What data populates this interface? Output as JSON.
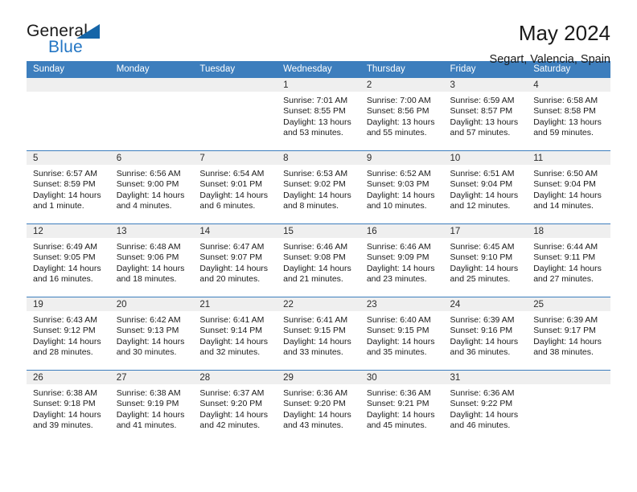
{
  "brand": {
    "name_part1": "General",
    "name_part2": "Blue",
    "triangle_color": "#1565a8",
    "blue_text_color": "#2376c4"
  },
  "header": {
    "title": "May 2024",
    "subtitle": "Segart, Valencia, Spain",
    "header_bg": "#3d7ebd",
    "header_text_color": "#ffffff",
    "daynum_band_bg": "#efefef"
  },
  "weekdays": [
    "Sunday",
    "Monday",
    "Tuesday",
    "Wednesday",
    "Thursday",
    "Friday",
    "Saturday"
  ],
  "weeks": [
    [
      {
        "day": "",
        "sunrise": "",
        "sunset": "",
        "daylight1": "",
        "daylight2": ""
      },
      {
        "day": "",
        "sunrise": "",
        "sunset": "",
        "daylight1": "",
        "daylight2": ""
      },
      {
        "day": "",
        "sunrise": "",
        "sunset": "",
        "daylight1": "",
        "daylight2": ""
      },
      {
        "day": "1",
        "sunrise": "Sunrise: 7:01 AM",
        "sunset": "Sunset: 8:55 PM",
        "daylight1": "Daylight: 13 hours",
        "daylight2": "and 53 minutes."
      },
      {
        "day": "2",
        "sunrise": "Sunrise: 7:00 AM",
        "sunset": "Sunset: 8:56 PM",
        "daylight1": "Daylight: 13 hours",
        "daylight2": "and 55 minutes."
      },
      {
        "day": "3",
        "sunrise": "Sunrise: 6:59 AM",
        "sunset": "Sunset: 8:57 PM",
        "daylight1": "Daylight: 13 hours",
        "daylight2": "and 57 minutes."
      },
      {
        "day": "4",
        "sunrise": "Sunrise: 6:58 AM",
        "sunset": "Sunset: 8:58 PM",
        "daylight1": "Daylight: 13 hours",
        "daylight2": "and 59 minutes."
      }
    ],
    [
      {
        "day": "5",
        "sunrise": "Sunrise: 6:57 AM",
        "sunset": "Sunset: 8:59 PM",
        "daylight1": "Daylight: 14 hours",
        "daylight2": "and 1 minute."
      },
      {
        "day": "6",
        "sunrise": "Sunrise: 6:56 AM",
        "sunset": "Sunset: 9:00 PM",
        "daylight1": "Daylight: 14 hours",
        "daylight2": "and 4 minutes."
      },
      {
        "day": "7",
        "sunrise": "Sunrise: 6:54 AM",
        "sunset": "Sunset: 9:01 PM",
        "daylight1": "Daylight: 14 hours",
        "daylight2": "and 6 minutes."
      },
      {
        "day": "8",
        "sunrise": "Sunrise: 6:53 AM",
        "sunset": "Sunset: 9:02 PM",
        "daylight1": "Daylight: 14 hours",
        "daylight2": "and 8 minutes."
      },
      {
        "day": "9",
        "sunrise": "Sunrise: 6:52 AM",
        "sunset": "Sunset: 9:03 PM",
        "daylight1": "Daylight: 14 hours",
        "daylight2": "and 10 minutes."
      },
      {
        "day": "10",
        "sunrise": "Sunrise: 6:51 AM",
        "sunset": "Sunset: 9:04 PM",
        "daylight1": "Daylight: 14 hours",
        "daylight2": "and 12 minutes."
      },
      {
        "day": "11",
        "sunrise": "Sunrise: 6:50 AM",
        "sunset": "Sunset: 9:04 PM",
        "daylight1": "Daylight: 14 hours",
        "daylight2": "and 14 minutes."
      }
    ],
    [
      {
        "day": "12",
        "sunrise": "Sunrise: 6:49 AM",
        "sunset": "Sunset: 9:05 PM",
        "daylight1": "Daylight: 14 hours",
        "daylight2": "and 16 minutes."
      },
      {
        "day": "13",
        "sunrise": "Sunrise: 6:48 AM",
        "sunset": "Sunset: 9:06 PM",
        "daylight1": "Daylight: 14 hours",
        "daylight2": "and 18 minutes."
      },
      {
        "day": "14",
        "sunrise": "Sunrise: 6:47 AM",
        "sunset": "Sunset: 9:07 PM",
        "daylight1": "Daylight: 14 hours",
        "daylight2": "and 20 minutes."
      },
      {
        "day": "15",
        "sunrise": "Sunrise: 6:46 AM",
        "sunset": "Sunset: 9:08 PM",
        "daylight1": "Daylight: 14 hours",
        "daylight2": "and 21 minutes."
      },
      {
        "day": "16",
        "sunrise": "Sunrise: 6:46 AM",
        "sunset": "Sunset: 9:09 PM",
        "daylight1": "Daylight: 14 hours",
        "daylight2": "and 23 minutes."
      },
      {
        "day": "17",
        "sunrise": "Sunrise: 6:45 AM",
        "sunset": "Sunset: 9:10 PM",
        "daylight1": "Daylight: 14 hours",
        "daylight2": "and 25 minutes."
      },
      {
        "day": "18",
        "sunrise": "Sunrise: 6:44 AM",
        "sunset": "Sunset: 9:11 PM",
        "daylight1": "Daylight: 14 hours",
        "daylight2": "and 27 minutes."
      }
    ],
    [
      {
        "day": "19",
        "sunrise": "Sunrise: 6:43 AM",
        "sunset": "Sunset: 9:12 PM",
        "daylight1": "Daylight: 14 hours",
        "daylight2": "and 28 minutes."
      },
      {
        "day": "20",
        "sunrise": "Sunrise: 6:42 AM",
        "sunset": "Sunset: 9:13 PM",
        "daylight1": "Daylight: 14 hours",
        "daylight2": "and 30 minutes."
      },
      {
        "day": "21",
        "sunrise": "Sunrise: 6:41 AM",
        "sunset": "Sunset: 9:14 PM",
        "daylight1": "Daylight: 14 hours",
        "daylight2": "and 32 minutes."
      },
      {
        "day": "22",
        "sunrise": "Sunrise: 6:41 AM",
        "sunset": "Sunset: 9:15 PM",
        "daylight1": "Daylight: 14 hours",
        "daylight2": "and 33 minutes."
      },
      {
        "day": "23",
        "sunrise": "Sunrise: 6:40 AM",
        "sunset": "Sunset: 9:15 PM",
        "daylight1": "Daylight: 14 hours",
        "daylight2": "and 35 minutes."
      },
      {
        "day": "24",
        "sunrise": "Sunrise: 6:39 AM",
        "sunset": "Sunset: 9:16 PM",
        "daylight1": "Daylight: 14 hours",
        "daylight2": "and 36 minutes."
      },
      {
        "day": "25",
        "sunrise": "Sunrise: 6:39 AM",
        "sunset": "Sunset: 9:17 PM",
        "daylight1": "Daylight: 14 hours",
        "daylight2": "and 38 minutes."
      }
    ],
    [
      {
        "day": "26",
        "sunrise": "Sunrise: 6:38 AM",
        "sunset": "Sunset: 9:18 PM",
        "daylight1": "Daylight: 14 hours",
        "daylight2": "and 39 minutes."
      },
      {
        "day": "27",
        "sunrise": "Sunrise: 6:38 AM",
        "sunset": "Sunset: 9:19 PM",
        "daylight1": "Daylight: 14 hours",
        "daylight2": "and 41 minutes."
      },
      {
        "day": "28",
        "sunrise": "Sunrise: 6:37 AM",
        "sunset": "Sunset: 9:20 PM",
        "daylight1": "Daylight: 14 hours",
        "daylight2": "and 42 minutes."
      },
      {
        "day": "29",
        "sunrise": "Sunrise: 6:36 AM",
        "sunset": "Sunset: 9:20 PM",
        "daylight1": "Daylight: 14 hours",
        "daylight2": "and 43 minutes."
      },
      {
        "day": "30",
        "sunrise": "Sunrise: 6:36 AM",
        "sunset": "Sunset: 9:21 PM",
        "daylight1": "Daylight: 14 hours",
        "daylight2": "and 45 minutes."
      },
      {
        "day": "31",
        "sunrise": "Sunrise: 6:36 AM",
        "sunset": "Sunset: 9:22 PM",
        "daylight1": "Daylight: 14 hours",
        "daylight2": "and 46 minutes."
      },
      {
        "day": "",
        "sunrise": "",
        "sunset": "",
        "daylight1": "",
        "daylight2": ""
      }
    ]
  ]
}
